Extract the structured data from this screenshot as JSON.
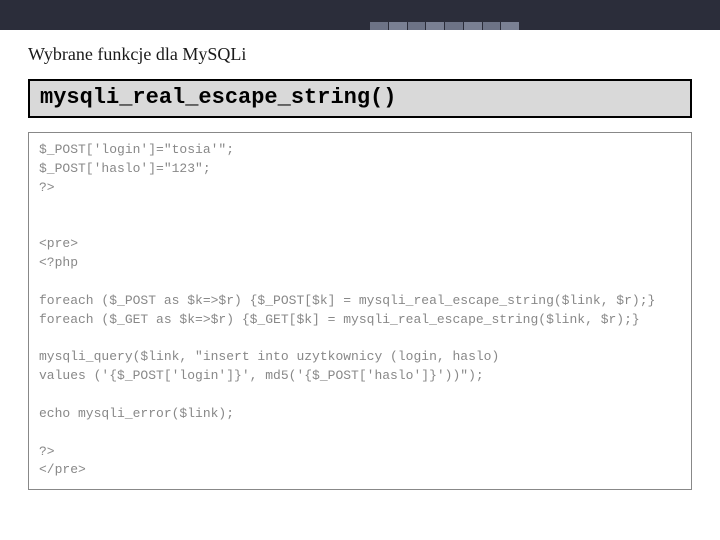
{
  "header": {
    "section_title": "Wybrane funkcje dla MySQLi"
  },
  "function_box": {
    "name": "mysqli_real_escape_string()"
  },
  "code": {
    "text": "$_POST['login']=\"tosia'\";\n$_POST['haslo']=\"123\";\n?>\n\n\n<pre>\n<?php\n\nforeach ($_POST as $k=>$r) {$_POST[$k] = mysqli_real_escape_string($link, $r);}\nforeach ($_GET as $k=>$r) {$_GET[$k] = mysqli_real_escape_string($link, $r);}\n\nmysqli_query($link, \"insert into uzytkownicy (login, haslo)\nvalues ('{$_POST['login']}', md5('{$_POST['haslo']}'))\");\n\necho mysqli_error($link);\n\n?>\n</pre>"
  }
}
